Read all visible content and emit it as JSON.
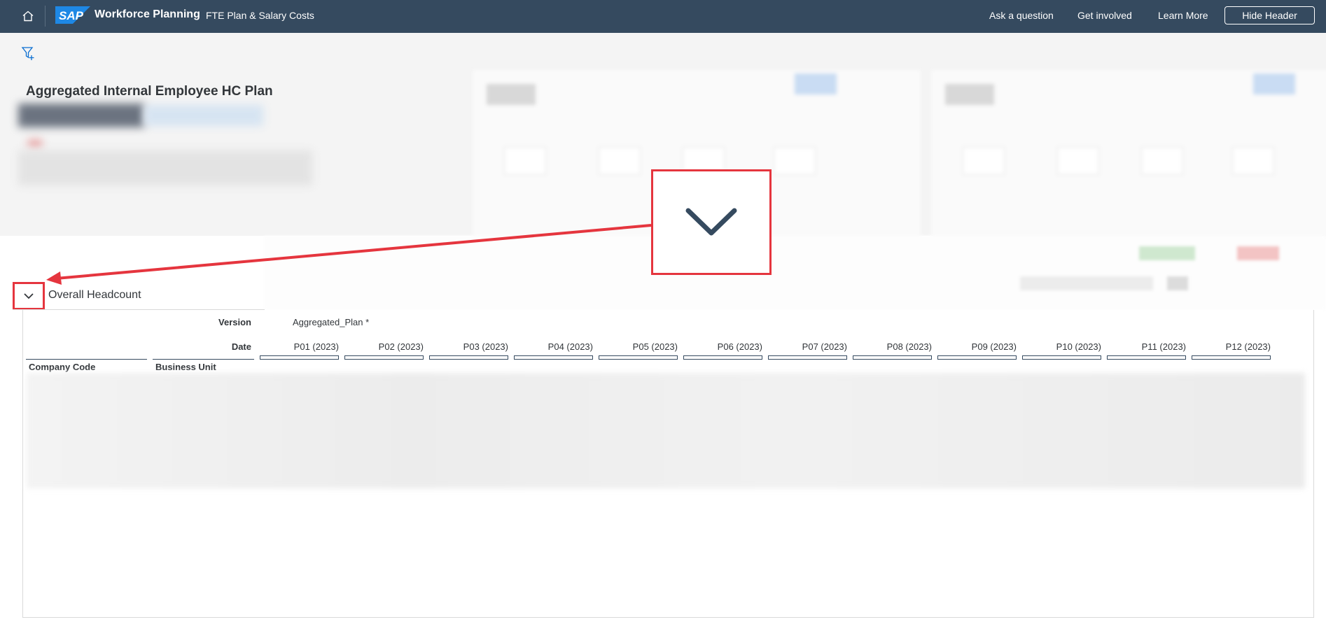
{
  "shell": {
    "app_title": "Workforce Planning",
    "app_subtitle": "FTE Plan & Salary Costs",
    "links": [
      "Ask a question",
      "Get involved",
      "Learn More"
    ],
    "hide_header_label": "Hide Header",
    "logo_text": "SAP"
  },
  "header": {
    "page_title": "Aggregated Internal Employee HC Plan"
  },
  "section": {
    "title": "Overall Headcount"
  },
  "table": {
    "version_label": "Version",
    "version_value": "Aggregated_Plan *",
    "date_label": "Date",
    "periods": [
      "P01 (2023)",
      "P02 (2023)",
      "P03 (2023)",
      "P04 (2023)",
      "P05 (2023)",
      "P06 (2023)",
      "P07 (2023)",
      "P08 (2023)",
      "P09 (2023)",
      "P10 (2023)",
      "P11 (2023)",
      "P12 (2023)"
    ],
    "columns": [
      "Company Code",
      "Business Unit"
    ]
  },
  "colors": {
    "shell_bg": "#354a5f",
    "callout_red": "#e5353e",
    "accent_blue": "#0a6ed1"
  }
}
